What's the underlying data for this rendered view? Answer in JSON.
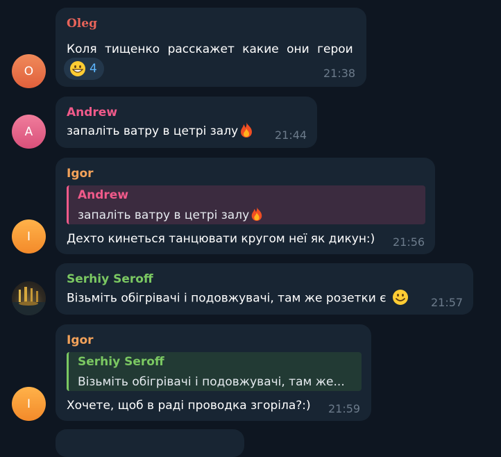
{
  "messages": [
    {
      "sender": "Olеg",
      "sender_color": "#e8645a",
      "avatar_letter": "O",
      "text": "Коля тищенко расскажет какие они герои",
      "reaction_count": "4",
      "time": "21:38"
    },
    {
      "sender": "Andrew",
      "sender_color": "#f05a8a",
      "avatar_letter": "A",
      "text": "запаліть ватру в цетрі залу",
      "time": "21:44"
    },
    {
      "sender": "Igor",
      "sender_color": "#f3a25a",
      "avatar_letter": "I",
      "reply_name": "Andrew",
      "reply_text": "запаліть ватру в цетрі залу",
      "text": "Дехто кинеться танцювати кругом неї як дикун:)",
      "time": "21:56"
    },
    {
      "sender": "Serhiy Seroff",
      "sender_color": "#7bc862",
      "text": "Візьміть обігрівачі і подовжувачі, там же розетки є",
      "time": "21:57"
    },
    {
      "sender": "Igor",
      "sender_color": "#f3a25a",
      "avatar_letter": "I",
      "reply_name": "Serhiy Seroff",
      "reply_text": "Візьміть обігрівачі і подовжувачі, там же...",
      "text": "Хочете, щоб в раді проводка згоріла?:)",
      "time": "21:59"
    }
  ],
  "icons": {
    "fire": "fire-emoji",
    "grin": "grinning-emoji",
    "smile": "smiling-emoji"
  }
}
